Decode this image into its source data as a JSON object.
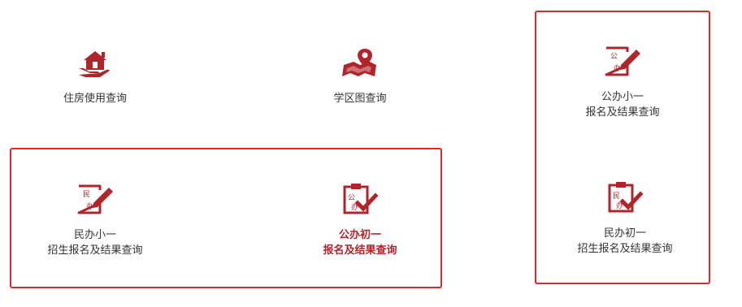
{
  "colors": {
    "icon": "#b0242c",
    "highlight_border": "#e0262a",
    "active_text": "#b0242c",
    "text": "#333333"
  },
  "tiles": [
    {
      "icon": "house-hand-icon",
      "line1": "住房使用查询",
      "line2": ""
    },
    {
      "icon": "map-pin-icon",
      "line1": "学区图查询",
      "line2": ""
    },
    {
      "icon": "public-document-pen-icon",
      "stamp1": "公",
      "stamp2": "办",
      "line1": "公办小一",
      "line2": "报名及结果查询"
    },
    {
      "icon": "private-document-pen-icon",
      "stamp1": "民",
      "stamp2": "办",
      "line1": "民办小一",
      "line2": "招生报名及结果查询"
    },
    {
      "icon": "public-clipboard-check-icon",
      "stamp1": "公",
      "stamp2": "办",
      "line1": "公办初一",
      "line2": "报名及结果查询"
    },
    {
      "icon": "private-clipboard-check-icon",
      "stamp1": "民",
      "stamp2": "办",
      "line1": "民办初一",
      "line2": "招生报名及结果查询"
    }
  ]
}
